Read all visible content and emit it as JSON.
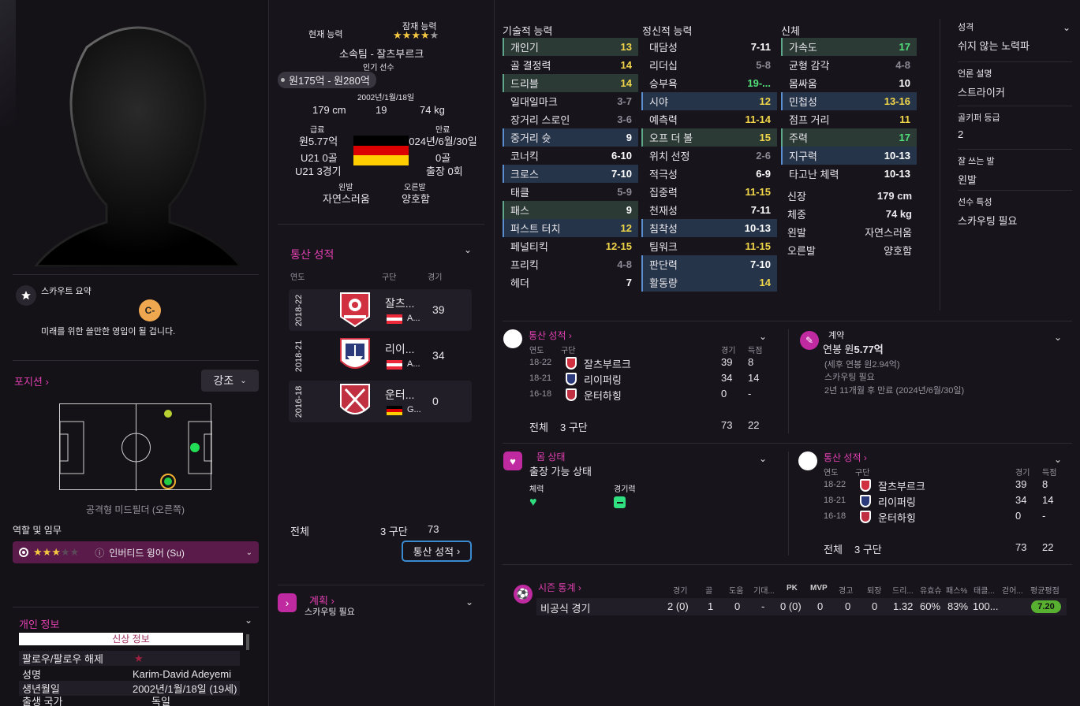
{
  "left": {
    "scout_summary_title": "스카우트 요약",
    "scout_grade": "C-",
    "scout_text": "미래를 위한 쓸만한 영입이 될 겁니다.",
    "position_title": "포지션",
    "emphasis_label": "강조",
    "position_name": "공격형 미드필더 (오른쪽)",
    "role_title": "역할 및 임무",
    "role_name": "인버티드 윙어 (Su)",
    "personal_info_title": "개인 정보",
    "personal_tab": "신상 정보",
    "rows": [
      {
        "label": "팔로우/팔로우 해제",
        "value": ""
      },
      {
        "label": "성명",
        "value": "Karim-David Adeyemi"
      },
      {
        "label": "생년월일",
        "value": "2002년/1월/18일 (19세)"
      },
      {
        "label": "출생 국가",
        "value": "독일"
      }
    ]
  },
  "info": {
    "current_ability_label": "현재 능력",
    "potential_ability_label": "잠재 능력",
    "club": "소속팀 - 잘츠부르크",
    "popular": "인기 선수",
    "value": "원175억 - 원280억",
    "value_low": "175",
    "value_high": "280",
    "dob": "2002년/1월/18일",
    "height": "179 cm",
    "age": "19",
    "weight": "74 kg",
    "wage_label": "급료",
    "wage": "원5.77억",
    "expiry_label": "만료",
    "expiry": "2024년/6월/30일",
    "u21_goals": "U21 0골",
    "u21_caps": "U21 3경기",
    "goals": "0골",
    "caps": "출장 0회",
    "left_foot_label": "왼발",
    "left_foot": "자연스러움",
    "right_foot_label": "오른발",
    "right_foot": "양호함"
  },
  "career": {
    "title": "통산 성적",
    "headers": [
      "연도",
      "구단",
      "경기"
    ],
    "rows": [
      {
        "year": "2018-22",
        "club": "잘츠...",
        "country": "A...",
        "apps": "39"
      },
      {
        "year": "2018-21",
        "club": "리이...",
        "country": "A...",
        "apps": "34"
      },
      {
        "year": "2016-18",
        "club": "운터...",
        "country": "G...",
        "apps": "0"
      }
    ],
    "total_label": "전체",
    "total_clubs": "3 구단",
    "total_apps": "73",
    "button": "통산 성적"
  },
  "plan": {
    "title": "계획",
    "sub": "스카우팅 필요"
  },
  "attributes": {
    "technical_title": "기술적 능력",
    "mental_title": "정신적 능력",
    "physical_title": "신체",
    "technical": [
      {
        "name": "개인기",
        "value": "13",
        "style": "y",
        "hl": "g"
      },
      {
        "name": "골 결정력",
        "value": "14",
        "style": "y",
        "hl": ""
      },
      {
        "name": "드리블",
        "value": "14",
        "style": "y",
        "hl": "g"
      },
      {
        "name": "일대일마크",
        "value": "3-7",
        "style": "gr",
        "hl": ""
      },
      {
        "name": "장거리 스로인",
        "value": "3-6",
        "style": "gr",
        "hl": ""
      },
      {
        "name": "중거리 슛",
        "value": "9",
        "style": "w",
        "hl": "b"
      },
      {
        "name": "코너킥",
        "value": "6-10",
        "style": "w",
        "hl": ""
      },
      {
        "name": "크로스",
        "value": "7-10",
        "style": "w",
        "hl": "b"
      },
      {
        "name": "태클",
        "value": "5-9",
        "style": "gr",
        "hl": ""
      },
      {
        "name": "패스",
        "value": "9",
        "style": "w",
        "hl": "g"
      },
      {
        "name": "퍼스트 터치",
        "value": "12",
        "style": "y",
        "hl": "b"
      },
      {
        "name": "페널티킥",
        "value": "12-15",
        "style": "y",
        "hl": ""
      },
      {
        "name": "프리킥",
        "value": "4-8",
        "style": "gr",
        "hl": ""
      },
      {
        "name": "헤더",
        "value": "7",
        "style": "w",
        "hl": ""
      }
    ],
    "mental": [
      {
        "name": "대담성",
        "value": "7-11",
        "style": "w",
        "hl": ""
      },
      {
        "name": "리더십",
        "value": "5-8",
        "style": "gr",
        "hl": ""
      },
      {
        "name": "승부욕",
        "value": "19-...",
        "style": "g",
        "hl": ""
      },
      {
        "name": "시야",
        "value": "12",
        "style": "y",
        "hl": "b"
      },
      {
        "name": "예측력",
        "value": "11-14",
        "style": "y",
        "hl": ""
      },
      {
        "name": "오프 더 볼",
        "value": "15",
        "style": "y",
        "hl": "g"
      },
      {
        "name": "위치 선정",
        "value": "2-6",
        "style": "gr",
        "hl": ""
      },
      {
        "name": "적극성",
        "value": "6-9",
        "style": "w",
        "hl": ""
      },
      {
        "name": "집중력",
        "value": "11-15",
        "style": "y",
        "hl": ""
      },
      {
        "name": "천재성",
        "value": "7-11",
        "style": "w",
        "hl": ""
      },
      {
        "name": "침착성",
        "value": "10-13",
        "style": "w",
        "hl": "b"
      },
      {
        "name": "팀워크",
        "value": "11-15",
        "style": "y",
        "hl": ""
      },
      {
        "name": "판단력",
        "value": "7-10",
        "style": "w",
        "hl": "b"
      },
      {
        "name": "활동량",
        "value": "14",
        "style": "y",
        "hl": "b"
      }
    ],
    "physical": [
      {
        "name": "가속도",
        "value": "17",
        "style": "g",
        "hl": "g"
      },
      {
        "name": "균형 감각",
        "value": "4-8",
        "style": "gr",
        "hl": ""
      },
      {
        "name": "몸싸움",
        "value": "10",
        "style": "w",
        "hl": ""
      },
      {
        "name": "민첩성",
        "value": "13-16",
        "style": "y",
        "hl": "b"
      },
      {
        "name": "점프 거리",
        "value": "11",
        "style": "y",
        "hl": ""
      },
      {
        "name": "주력",
        "value": "17",
        "style": "g",
        "hl": "g"
      },
      {
        "name": "지구력",
        "value": "10-13",
        "style": "w",
        "hl": "b"
      },
      {
        "name": "타고난 체력",
        "value": "10-13",
        "style": "w",
        "hl": ""
      }
    ],
    "physical_info": [
      {
        "label": "신장",
        "value": "179 cm"
      },
      {
        "label": "체중",
        "value": "74 kg"
      },
      {
        "label": "왼발",
        "value": "자연스러움"
      },
      {
        "label": "오른발",
        "value": "양호함"
      }
    ]
  },
  "side": [
    {
      "label": "성격",
      "value": "쉬지 않는 노력파"
    },
    {
      "label": "언론 설명",
      "value": "스트라이커"
    },
    {
      "label": "골키퍼 등급",
      "value": "2"
    },
    {
      "label": "잘 쓰는 발",
      "value": "왼발"
    },
    {
      "label": "선수 특성",
      "value": "스카우팅 필요"
    }
  ],
  "career2": {
    "title": "통산 성적",
    "headers": [
      "연도",
      "구단",
      "경기",
      "득점"
    ],
    "rows": [
      {
        "year": "18-22",
        "club": "잘츠부르크",
        "apps": "39",
        "goals": "8"
      },
      {
        "year": "18-21",
        "club": "리이퍼링",
        "apps": "34",
        "goals": "14"
      },
      {
        "year": "16-18",
        "club": "운터하힝",
        "apps": "0",
        "goals": "-"
      }
    ],
    "total_label": "전체",
    "total_clubs": "3 구단",
    "total_apps": "73",
    "total_goals": "22"
  },
  "contract": {
    "title": "계약",
    "salary_prefix": "연봉 원",
    "salary": "5.77억",
    "after_tax": "(세후 연봉 원2.94억)",
    "scouting": "스카우팅 필요",
    "expiry": "2년 11개월 후 만료 (2024년/6월/30일)"
  },
  "fitness": {
    "title": "몸 상태",
    "status": "출장 가능 상태",
    "stamina_label": "체력",
    "match_label": "경기력"
  },
  "season": {
    "title": "시즌 통계",
    "headers": [
      "경기",
      "골",
      "도움",
      "기대...",
      "PK",
      "MVP",
      "경고",
      "퇴장",
      "드리...",
      "유효슈",
      "패스%",
      "태클...",
      "걷어...",
      "평균평점"
    ],
    "row_label": "비공식 경기",
    "values": [
      "2 (0)",
      "1",
      "0",
      "-",
      "0 (0)",
      "0",
      "0",
      "0",
      "1.32",
      "60%",
      "83%",
      "100...",
      "",
      "7.20"
    ]
  }
}
